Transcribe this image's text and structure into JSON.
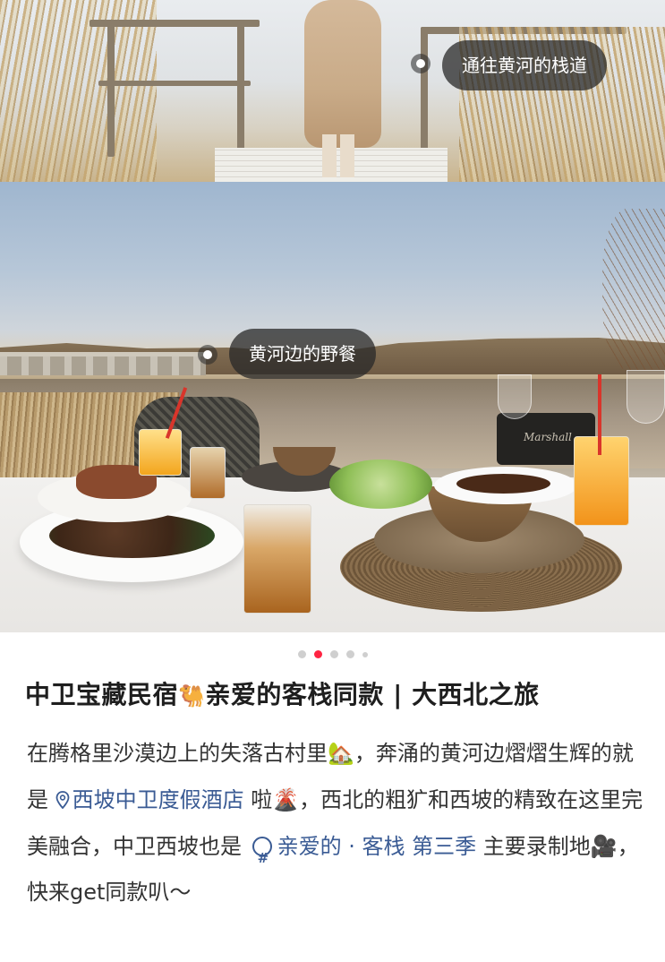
{
  "photos": {
    "top_tag": "通往黄河的栈道",
    "main_tag": "黄河边的野餐",
    "speaker_brand": "Marshall"
  },
  "carousel": {
    "count": 5,
    "active_index": 1
  },
  "post": {
    "title_part1": "中卫宝藏民宿",
    "title_emoji": "🐫",
    "title_part2": "亲爱的客栈同款 | 大西北之旅",
    "body": {
      "t1": "在腾格里沙漠边上的失落古村里",
      "e1": "🏡",
      "t2": "，奔涌的黄河边熠熠生辉的就是",
      "location_link": "西坡中卫度假酒店",
      "t3": "啦",
      "e2": "🌋",
      "t4": "，西北的粗犷和西坡的精致在这里完美融合，中卫西坡也是",
      "topic_link": "亲爱的 · 客栈 第三季",
      "t5": "主要录制地",
      "e3": "🎥",
      "t6": "，快来get同款叭～"
    }
  },
  "colors": {
    "accent": "#ff2442",
    "link": "#3a5b94",
    "tag_bg": "#282828"
  }
}
